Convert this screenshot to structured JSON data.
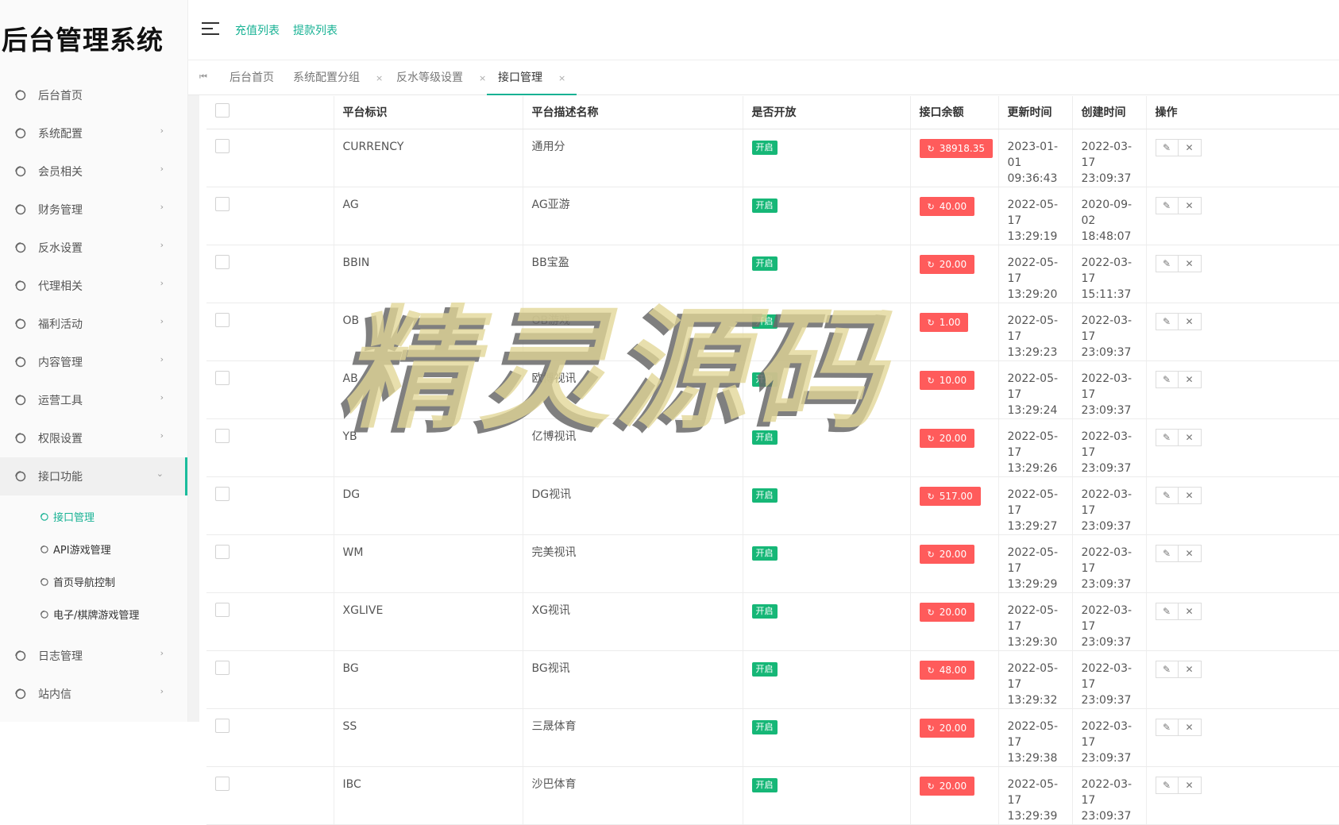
{
  "sidebar": {
    "title": "后台管理系统",
    "menu": [
      {
        "label": "后台首页"
      },
      {
        "label": "系统配置"
      },
      {
        "label": "会员相关"
      },
      {
        "label": "财务管理"
      },
      {
        "label": "反水设置"
      },
      {
        "label": "代理相关"
      },
      {
        "label": "福利活动"
      },
      {
        "label": "内容管理"
      },
      {
        "label": "运营工具"
      },
      {
        "label": "权限设置"
      },
      {
        "label": "接口功能"
      },
      {
        "label": "日志管理"
      },
      {
        "label": "站内信"
      }
    ],
    "submenu": [
      {
        "label": "接口管理"
      },
      {
        "label": "API游戏管理"
      },
      {
        "label": "首页导航控制"
      },
      {
        "label": "电子/棋牌游戏管理"
      }
    ]
  },
  "topbar": {
    "links": [
      "充值列表",
      "提款列表"
    ]
  },
  "tabs": [
    {
      "label": "后台首页"
    },
    {
      "label": "系统配置分组"
    },
    {
      "label": "反水等级设置"
    },
    {
      "label": "接口管理"
    }
  ],
  "tab_close": "×",
  "table": {
    "headers": [
      "平台标识",
      "平台描述名称",
      "是否开放",
      "接口余额",
      "更新时间",
      "创建时间",
      "操作"
    ],
    "rows": [
      {
        "code": "CURRENCY",
        "name": "通用分",
        "status": "开启",
        "balance": "38918.35",
        "updated": "2023-01-01",
        "updated_t": "09:36:43",
        "created": "2022-03-17",
        "created_t": "23:09:37"
      },
      {
        "code": "AG",
        "name": "AG亚游",
        "status": "开启",
        "balance": "40.00",
        "updated": "2022-05-17",
        "updated_t": "13:29:19",
        "created": "2020-09-02",
        "created_t": "18:48:07"
      },
      {
        "code": "BBIN",
        "name": "BB宝盈",
        "status": "开启",
        "balance": "20.00",
        "updated": "2022-05-17",
        "updated_t": "13:29:20",
        "created": "2022-03-17",
        "created_t": "15:11:37"
      },
      {
        "code": "OB",
        "name": "OB游戏",
        "status": "开启",
        "balance": "1.00",
        "updated": "2022-05-17",
        "updated_t": "13:29:23",
        "created": "2022-03-17",
        "created_t": "23:09:37"
      },
      {
        "code": "AB",
        "name": "欧博视讯",
        "status": "开启",
        "balance": "10.00",
        "updated": "2022-05-17",
        "updated_t": "13:29:24",
        "created": "2022-03-17",
        "created_t": "23:09:37"
      },
      {
        "code": "YB",
        "name": "亿博视讯",
        "status": "开启",
        "balance": "20.00",
        "updated": "2022-05-17",
        "updated_t": "13:29:26",
        "created": "2022-03-17",
        "created_t": "23:09:37"
      },
      {
        "code": "DG",
        "name": "DG视讯",
        "status": "开启",
        "balance": "517.00",
        "updated": "2022-05-17",
        "updated_t": "13:29:27",
        "created": "2022-03-17",
        "created_t": "23:09:37"
      },
      {
        "code": "WM",
        "name": "完美视讯",
        "status": "开启",
        "balance": "20.00",
        "updated": "2022-05-17",
        "updated_t": "13:29:29",
        "created": "2022-03-17",
        "created_t": "23:09:37"
      },
      {
        "code": "XGLIVE",
        "name": "XG视讯",
        "status": "开启",
        "balance": "20.00",
        "updated": "2022-05-17",
        "updated_t": "13:29:30",
        "created": "2022-03-17",
        "created_t": "23:09:37"
      },
      {
        "code": "BG",
        "name": "BG视讯",
        "status": "开启",
        "balance": "48.00",
        "updated": "2022-05-17",
        "updated_t": "13:29:32",
        "created": "2022-03-17",
        "created_t": "23:09:37"
      },
      {
        "code": "SS",
        "name": "三晟体育",
        "status": "开启",
        "balance": "20.00",
        "updated": "2022-05-17",
        "updated_t": "13:29:38",
        "created": "2022-03-17",
        "created_t": "23:09:37"
      },
      {
        "code": "IBC",
        "name": "沙巴体育",
        "status": "开启",
        "balance": "20.00",
        "updated": "2022-05-17",
        "updated_t": "13:29:39",
        "created": "2022-03-17",
        "created_t": "23:09:37"
      }
    ]
  },
  "icons": {
    "refresh": "refresh-icon",
    "edit": "edit-icon",
    "close": "close-icon",
    "menu": "circle-icon"
  },
  "watermark": "精灵源码",
  "colors": {
    "accent": "#18b294",
    "open_badge": "#16b777",
    "balance_badge": "#ff5b5b"
  }
}
